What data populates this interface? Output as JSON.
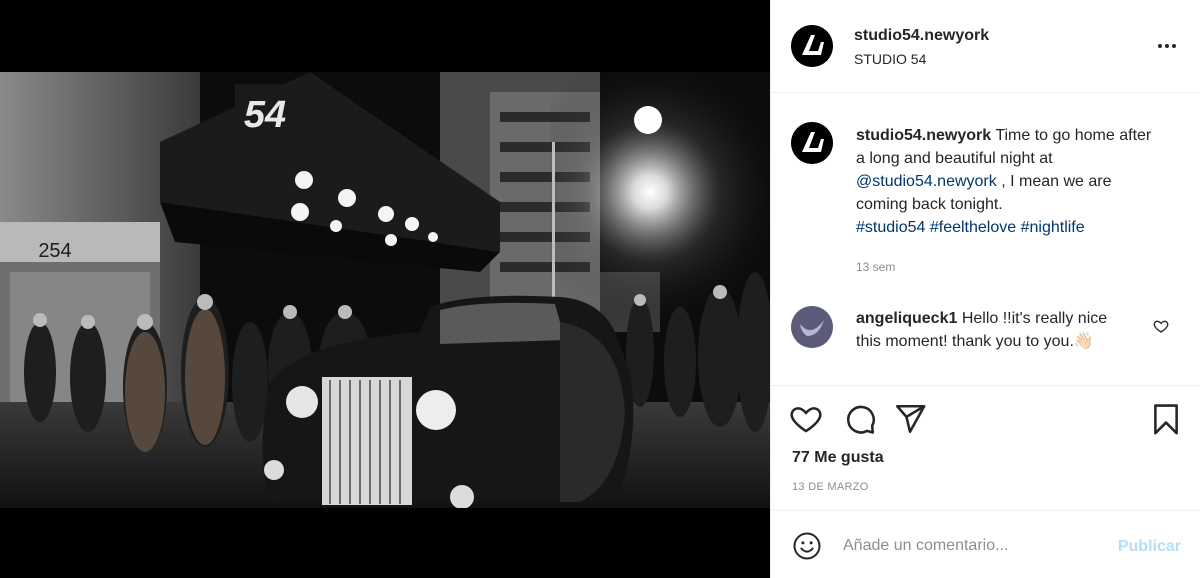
{
  "post": {
    "header": {
      "username": "studio54.newyork",
      "subtitle": "STUDIO 54"
    },
    "caption": {
      "username": "studio54.newyork",
      "text_1": " Time to go home after a long and beautiful night at ",
      "mention": "@studio54.newyork",
      "text_2": " , I mean we are coming back tonight.",
      "hashtags": [
        "#studio54",
        "#feelthelove",
        "#nightlife"
      ],
      "time_ago": "13 sem"
    },
    "comments": [
      {
        "username": "angeliqueck1",
        "text": " Hello !!it's really nice this moment! thank you to you.👋🏻"
      }
    ],
    "likes": "77 Me gusta",
    "date": "13 DE MARZO",
    "add_comment": {
      "placeholder": "Añade un comentario...",
      "publish_label": "Publicar"
    }
  },
  "photo": {
    "sign_text": "54",
    "address_text": "254"
  },
  "icons": {
    "like": "heart-icon",
    "comment": "comment-icon",
    "share": "share-icon",
    "save": "bookmark-icon",
    "emoji": "emoji-icon",
    "more": "more-options-icon"
  }
}
